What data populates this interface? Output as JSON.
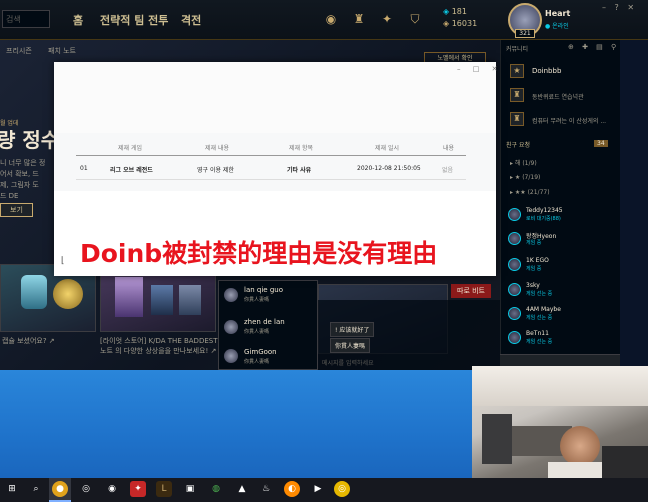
{
  "topbar": {
    "search_placeholder": "검색",
    "tabs": [
      "홈",
      "전략적 팀 전투",
      "격전"
    ],
    "rp": "181",
    "be": "16031",
    "username": "Heart",
    "status": "온라인",
    "level": "321"
  },
  "main": {
    "subnav": [
      "프리시즌",
      "패치 노트"
    ],
    "promo_sub": "월 업데",
    "promo_title": "량 정수",
    "promo_text": [
      "니 너무 많은 정",
      "어서 확보, 드",
      "제, 그림자 도",
      "드 DE"
    ],
    "promo_button": "보기",
    "top_right_button": "노벨에서 확인",
    "card_captions": [
      "캡슐 보셨어요? ↗",
      "[라이엇 스토어] K/DA THE BADDEST",
      "노트 의 다양한 상상을을 만나보세요! ↗"
    ],
    "red_button": "따로 비트"
  },
  "dialog": {
    "headers": [
      "제재 게임",
      "제재 내용",
      "제재 항목",
      "제재 일시",
      "내용"
    ],
    "row": [
      "01",
      "리그 오브 레전드",
      "영구 이용 제한",
      "기타 사유",
      "2020-12-08 21:50:05",
      "없음"
    ],
    "caption": "Doinb被封禁的理由是没有理由"
  },
  "social": {
    "header": "커뮤니티",
    "clubs": [
      {
        "name": "Doinbbb",
        "sub": ""
      },
      {
        "name": "동반퀴료드 연습넉관",
        "sub": ""
      },
      {
        "name": "컴퓨터 무려는 이 산성게의 ...",
        "sub": ""
      }
    ],
    "group_header": "친구 요청",
    "group_count": "34",
    "groups": [
      "▸ 해 (1/9)",
      "▸ ★ (7/19)",
      "▸ ★★ (21/77)"
    ],
    "friends": [
      {
        "name": "Teddy12345",
        "status": "로비 대기중(88)"
      },
      {
        "name": "왕정Hyeon",
        "status": "게임 중"
      },
      {
        "name": "1K EGO",
        "status": "게임 중"
      },
      {
        "name": "3sky",
        "status": "게임 선는 중"
      },
      {
        "name": "4AM Maybe",
        "status": "게임 선는 중"
      },
      {
        "name": "BeTn11",
        "status": "게임 선는 중"
      }
    ]
  },
  "chat": {
    "contacts": [
      {
        "name": "lan qie guo",
        "sub": "你貫人妻嗎"
      },
      {
        "name": "zhen de lan",
        "sub": "你貫人妻嗎"
      },
      {
        "name": "GimGoon",
        "sub": "你貫人妻嗎"
      }
    ],
    "bubble1": "! 应该就好了",
    "bubble2": "你貫人妻嗎",
    "input_placeholder": "메시지를 입력하세요"
  },
  "colors": {
    "gold": "#c8aa6e",
    "caption_red": "#e8141e",
    "desktop_blue": "#2a86da"
  }
}
